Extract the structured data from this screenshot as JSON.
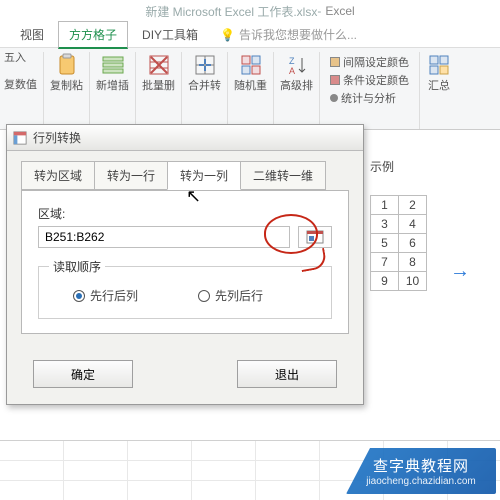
{
  "title": {
    "doc": "新建 Microsoft Excel 工作表.xlsx",
    "app": "Excel"
  },
  "menu": {
    "view": "视图",
    "ffgz": "方方格子",
    "diy": "DIY工具箱",
    "tellme": "告诉我您想要做什么..."
  },
  "stubs": {
    "left1": "五入",
    "left2": "复数值"
  },
  "ribbon": {
    "copy": "复制粘",
    "add": "新增插",
    "bulk": "批量删",
    "merge": "合并转",
    "shuffle": "随机重",
    "sort": "高级排",
    "interval": "间隔设定颜色",
    "cond": "条件设定颜色",
    "stats": "统计与分析",
    "sum": "汇总"
  },
  "dialog": {
    "title": "行列转换",
    "tabs": {
      "area": "转为区域",
      "row": "转为一行",
      "col": "转为一列",
      "dim": "二维转一维"
    },
    "range_label": "区域:",
    "range_value": "B251:B262",
    "order_title": "读取顺序",
    "opt_row_first": "先行后列",
    "opt_col_first": "先列后行",
    "ok": "确定",
    "cancel": "退出"
  },
  "example": {
    "title": "示例",
    "grid": [
      [
        "1",
        "2"
      ],
      [
        "3",
        "4"
      ],
      [
        "5",
        "6"
      ],
      [
        "7",
        "8"
      ],
      [
        "9",
        "10"
      ]
    ]
  },
  "watermark": {
    "big": "查字典教程网",
    "small": "jiaocheng.chazidian.com"
  }
}
